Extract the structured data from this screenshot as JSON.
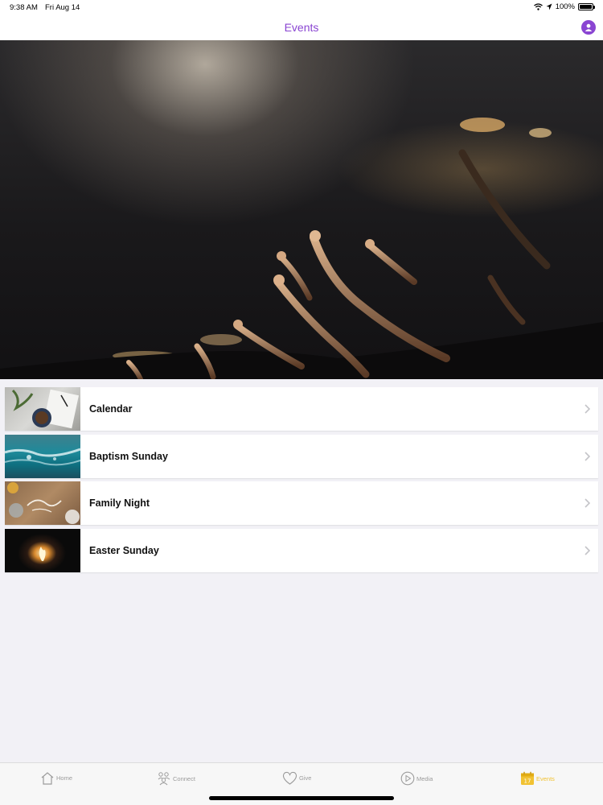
{
  "status_bar": {
    "time": "9:38 AM",
    "date": "Fri Aug 14",
    "battery": "100%"
  },
  "nav": {
    "title": "Events",
    "profile_icon": "person-circle-icon"
  },
  "colors": {
    "accent": "#8a45d2",
    "active_tab": "#f1c232",
    "inactive_tab": "#9b9b9b",
    "background": "#f2f1f6"
  },
  "events": [
    {
      "label": "Calendar",
      "thumb": "notebook-coffee-photo"
    },
    {
      "label": "Baptism Sunday",
      "thumb": "ocean-water-photo"
    },
    {
      "label": "Family Night",
      "thumb": "family-table-photo"
    },
    {
      "label": "Easter Sunday",
      "thumb": "fire-in-dark-photo"
    }
  ],
  "tabs": [
    {
      "label": "Home",
      "icon": "house-icon",
      "active": false
    },
    {
      "label": "Connect",
      "icon": "people-icon",
      "active": false
    },
    {
      "label": "Give",
      "icon": "heart-icon",
      "active": false
    },
    {
      "label": "Media",
      "icon": "play-circle-icon",
      "active": false
    },
    {
      "label": "Events",
      "icon": "calendar-icon",
      "active": true
    }
  ]
}
